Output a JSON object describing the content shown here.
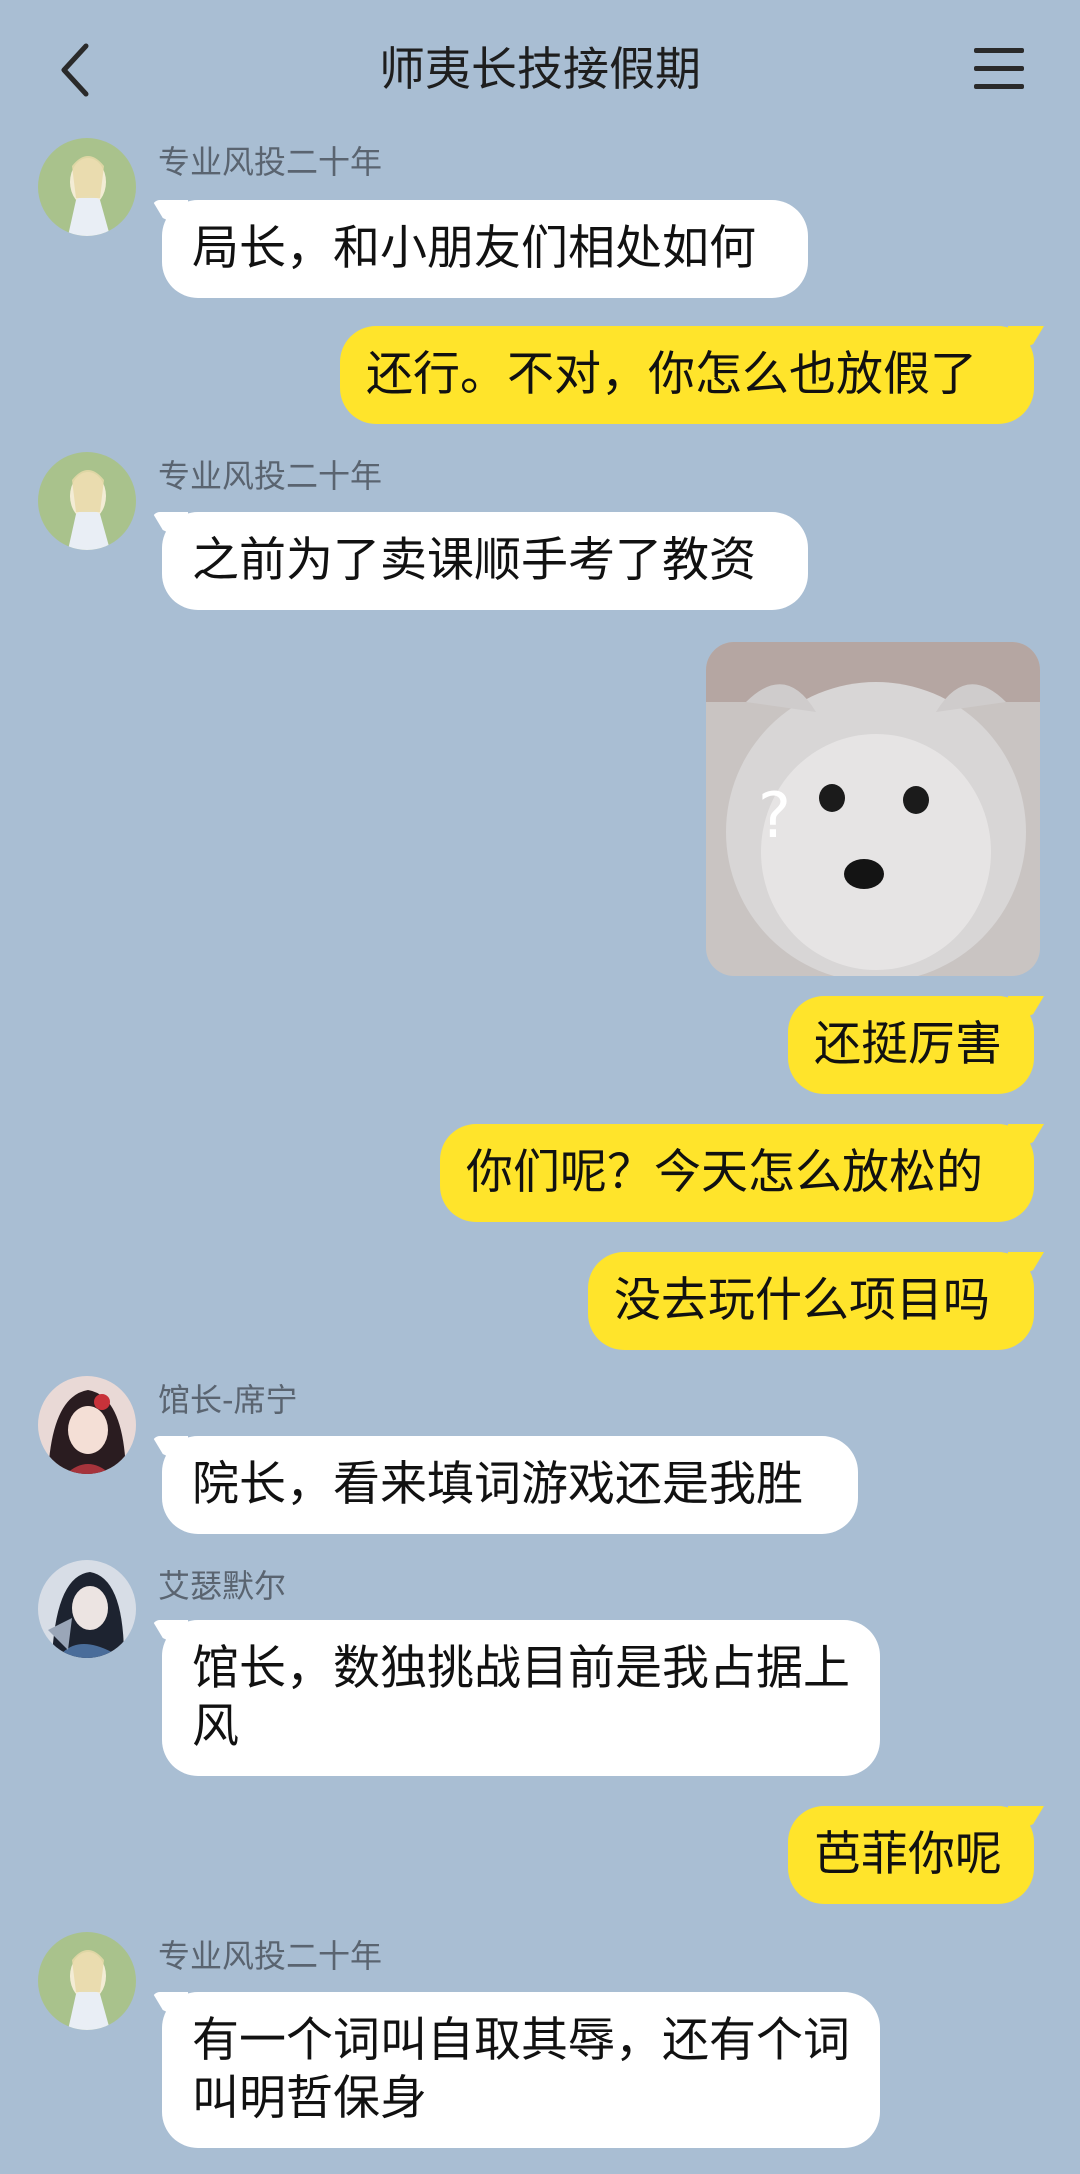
{
  "header": {
    "title": "师夷长技接假期"
  },
  "messages": [
    {
      "type": "in",
      "sender": "专业风投二十年",
      "text": "局长，和小朋友们相处如何"
    },
    {
      "type": "out",
      "text": "还行。不对，你怎么也放假了"
    },
    {
      "type": "in",
      "sender": "专业风投二十年",
      "text": "之前为了卖课顺手考了教资"
    },
    {
      "type": "out-image",
      "icon": "confused-dog-sticker",
      "text": "?"
    },
    {
      "type": "out",
      "text": "还挺厉害"
    },
    {
      "type": "out",
      "text": "你们呢？今天怎么放松的"
    },
    {
      "type": "out",
      "text": "没去玩什么项目吗"
    },
    {
      "type": "in",
      "sender": "馆长-席宁",
      "text": "院长，看来填词游戏还是我胜"
    },
    {
      "type": "in",
      "sender": "艾瑟默尔",
      "text": "馆长，数独挑战目前是我占据上风"
    },
    {
      "type": "out",
      "text": "芭菲你呢"
    },
    {
      "type": "in",
      "sender": "专业风投二十年",
      "text": "有一个词叫自取其辱，还有个词叫明哲保身"
    }
  ],
  "colors": {
    "background": "#a9bed3",
    "incoming_bubble": "#ffffff",
    "outgoing_bubble": "#ffe42b"
  }
}
